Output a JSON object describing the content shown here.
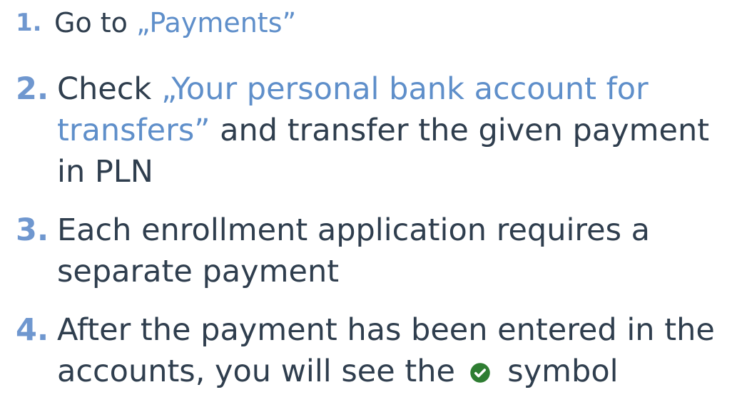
{
  "steps": [
    {
      "number": "1.",
      "prefix": "Go to ",
      "highlight": "„Payments”",
      "suffix": ""
    },
    {
      "number": "2.",
      "prefix": "Check ",
      "highlight": "„Your personal bank account for transfers”",
      "suffix": " and transfer the given payment in PLN"
    },
    {
      "number": "3.",
      "text": "Each enrollment application requires a separate payment"
    },
    {
      "number": "4.",
      "before_icon": "After the payment has been entered in the accounts, you will see the",
      "icon": "check-circle-icon",
      "after_icon": "symbol"
    }
  ],
  "colors": {
    "accent": "#5f8fca",
    "number": "#6f97cf",
    "body_text": "#2f3e4e",
    "check_icon": "#2e7d32"
  }
}
